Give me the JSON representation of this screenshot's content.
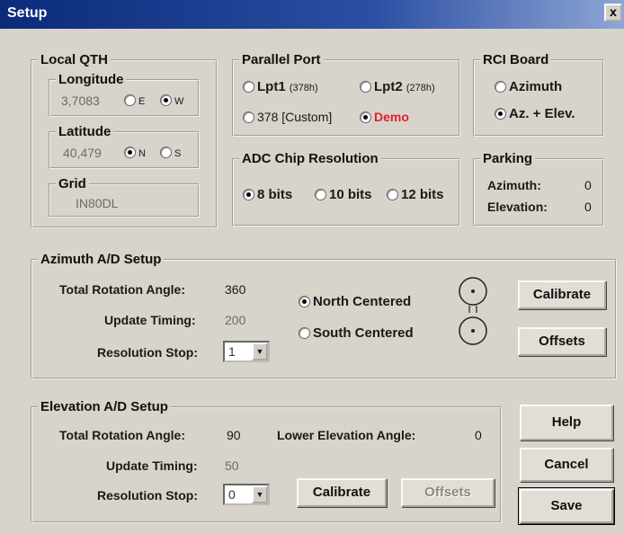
{
  "window": {
    "title": "Setup",
    "close_label": "x"
  },
  "local_qth": {
    "legend": "Local QTH",
    "longitude": {
      "legend": "Longitude",
      "value": "3,7083",
      "options": [
        "E",
        "W"
      ],
      "selected": "W"
    },
    "latitude": {
      "legend": "Latitude",
      "value": "40,479",
      "options": [
        "N",
        "S"
      ],
      "selected": "N"
    },
    "grid": {
      "legend": "Grid",
      "value": "IN80DL"
    }
  },
  "parallel_port": {
    "legend": "Parallel Port",
    "lpt1": {
      "label": "Lpt1",
      "addr": "(378h)"
    },
    "lpt2": {
      "label": "Lpt2",
      "addr": "(278h)"
    },
    "custom": {
      "label": "378",
      "note": "[Custom]"
    },
    "demo": {
      "label": "Demo"
    },
    "selected": "Demo"
  },
  "rci_board": {
    "legend": "RCI Board",
    "options": [
      "Azimuth",
      "Az. + Elev."
    ],
    "selected": "Az. + Elev."
  },
  "adc": {
    "legend": "ADC Chip Resolution",
    "options": [
      "8 bits",
      "10 bits",
      "12 bits"
    ],
    "selected": "8 bits"
  },
  "parking": {
    "legend": "Parking",
    "azimuth_label": "Azimuth:",
    "azimuth_value": "0",
    "elevation_label": "Elevation:",
    "elevation_value": "0"
  },
  "azimuth_ad": {
    "legend": "Azimuth A/D Setup",
    "rotation_label": "Total Rotation Angle:",
    "rotation_value": "360",
    "timing_label": "Update Timing:",
    "timing_value": "200",
    "resolution_label": "Resolution Stop:",
    "resolution_value": "1",
    "north_label": "North Centered",
    "south_label": "South Centered",
    "selected": "North Centered",
    "calibrate_label": "Calibrate",
    "offsets_label": "Offsets"
  },
  "elevation_ad": {
    "legend": "Elevation A/D Setup",
    "rotation_label": "Total Rotation Angle:",
    "rotation_value": "90",
    "lower_label": "Lower Elevation Angle:",
    "lower_value": "0",
    "timing_label": "Update Timing:",
    "timing_value": "50",
    "resolution_label": "Resolution Stop:",
    "resolution_value": "0",
    "calibrate_label": "Calibrate",
    "offsets_label": "Offsets"
  },
  "buttons": {
    "help": "Help",
    "cancel": "Cancel",
    "save": "Save"
  }
}
